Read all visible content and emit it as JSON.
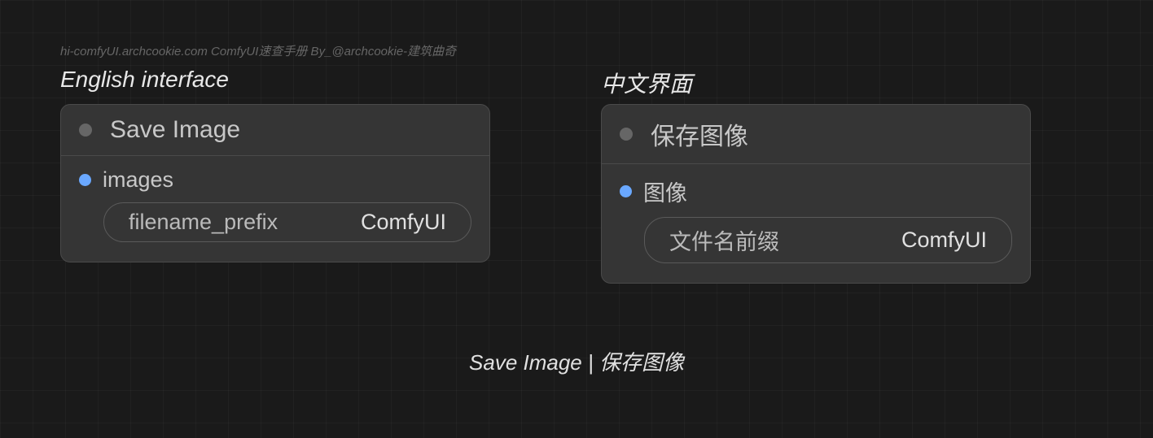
{
  "watermark": "hi-comfyUI.archcookie.com ComfyUI速查手册 By_@archcookie-建筑曲奇",
  "labels": {
    "en": "English interface",
    "zh": "中文界面"
  },
  "nodes": {
    "en": {
      "title": "Save Image",
      "input_label": "images",
      "param_label": "filename_prefix",
      "param_value": "ComfyUI"
    },
    "zh": {
      "title": "保存图像",
      "input_label": "图像",
      "param_label": "文件名前缀",
      "param_value": "ComfyUI"
    }
  },
  "caption": "Save Image | 保存图像"
}
